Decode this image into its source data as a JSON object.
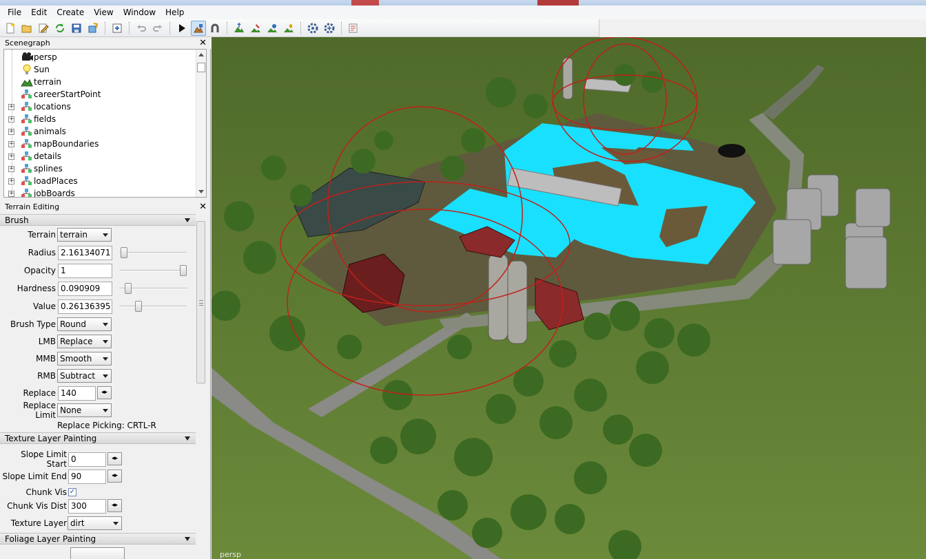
{
  "menu": [
    "File",
    "Edit",
    "Create",
    "View",
    "Window",
    "Help"
  ],
  "toolbar": {
    "buttons": [
      "new-icon",
      "open-icon",
      "edit-icon",
      "refresh-icon",
      "save-icon",
      "export-icon",
      "import-icon",
      "undo-icon",
      "redo-icon",
      "play-icon",
      "terrain-tool-icon",
      "magnet-icon",
      "terrain-raise-icon",
      "terrain-paint-icon",
      "foliage-icon",
      "plant-icon",
      "settings-icon",
      "settings-alt-icon",
      "script-icon"
    ]
  },
  "scenegraph": {
    "title": "Scenegraph",
    "items": [
      {
        "label": "persp",
        "icon": "camera-icon",
        "expandable": false
      },
      {
        "label": "Sun",
        "icon": "light-icon",
        "expandable": false
      },
      {
        "label": "terrain",
        "icon": "terrain-icon",
        "expandable": false
      },
      {
        "label": "careerStartPoint",
        "icon": "transform-group-icon",
        "expandable": false
      },
      {
        "label": "locations",
        "icon": "transform-group-icon",
        "expandable": true
      },
      {
        "label": "fields",
        "icon": "transform-group-icon",
        "expandable": true
      },
      {
        "label": "animals",
        "icon": "transform-group-icon",
        "expandable": true
      },
      {
        "label": "mapBoundaries",
        "icon": "transform-group-icon",
        "expandable": true
      },
      {
        "label": "details",
        "icon": "transform-group-icon",
        "expandable": true
      },
      {
        "label": "splines",
        "icon": "transform-group-icon",
        "expandable": true
      },
      {
        "label": "loadPlaces",
        "icon": "transform-group-icon",
        "expandable": true
      },
      {
        "label": "jobBoards",
        "icon": "transform-group-icon",
        "expandable": true
      }
    ]
  },
  "terrain_editing": {
    "title": "Terrain Editing",
    "brush": {
      "section": "Brush",
      "terrain_label": "Terrain",
      "terrain_value": "terrain",
      "radius_label": "Radius",
      "radius_value": "2.16134071",
      "radius_level": 0.02,
      "opacity_label": "Opacity",
      "opacity_value": "1",
      "opacity_level": 1.0,
      "hardness_label": "Hardness",
      "hardness_value": "0.090909",
      "hardness_level": 0.09,
      "value_label": "Value",
      "value_value": "0.26136395",
      "value_level": 0.26,
      "brush_type_label": "Brush Type",
      "brush_type_value": "Round",
      "lmb_label": "LMB",
      "lmb_value": "Replace",
      "mmb_label": "MMB",
      "mmb_value": "Smooth",
      "rmb_label": "RMB",
      "rmb_value": "Subtract",
      "replace_label": "Replace",
      "replace_value": "140",
      "replace_limit_label": "Replace Limit",
      "replace_limit_value": "None",
      "replace_picking": "Replace Picking: CRTL-R"
    },
    "texture": {
      "section": "Texture Layer Painting",
      "slope_start_label": "Slope Limit Start",
      "slope_start_value": "0",
      "slope_end_label": "Slope Limit End",
      "slope_end_value": "90",
      "chunk_vis_label": "Chunk Vis",
      "chunk_vis_checked": true,
      "chunk_vis_mark": "✓",
      "chunk_vis_dist_label": "Chunk Vis Dist",
      "chunk_vis_dist_value": "300",
      "texture_layer_label": "Texture Layer",
      "texture_layer_value": "dirt"
    },
    "foliage": {
      "section": "Foliage Layer Painting"
    }
  },
  "viewport": {
    "camera_label": "persp",
    "colors": {
      "grass": "#5e7a33",
      "water_plane": "#19e0ff",
      "gizmo": "#c0201a",
      "road": "#8a8a86"
    }
  },
  "spinner_glyph": "◂▸"
}
